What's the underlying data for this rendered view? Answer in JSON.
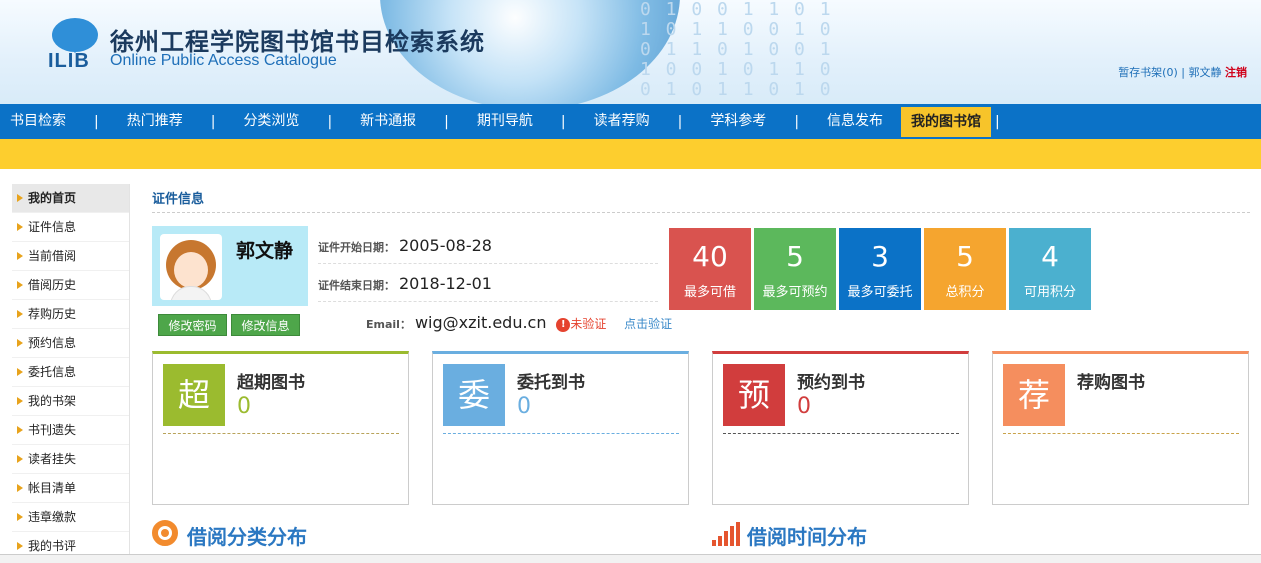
{
  "header": {
    "logo_text": "ILIB",
    "title": "徐州工程学院图书馆书目检索系统",
    "subtitle": "Online Public Access Catalogue",
    "links": {
      "bookshelf": "暂存书架(0)",
      "separator": "|",
      "user": "郭文静",
      "logout": "注销"
    }
  },
  "nav": {
    "items": [
      "书目检索",
      "热门推荐",
      "分类浏览",
      "新书通报",
      "期刊导航",
      "读者荐购",
      "学科参考",
      "信息发布"
    ],
    "separator": "|",
    "active": "我的图书馆"
  },
  "sidebar": {
    "items": [
      "我的首页",
      "证件信息",
      "当前借阅",
      "借阅历史",
      "荐购历史",
      "预约信息",
      "委托信息",
      "我的书架",
      "书刊遗失",
      "读者挂失",
      "帐目清单",
      "违章缴款",
      "我的书评"
    ]
  },
  "section": {
    "title": "证件信息"
  },
  "profile": {
    "name": "郭文静",
    "change_password": "修改密码",
    "change_info": "修改信息",
    "start_label": "证件开始日期：",
    "start_value": "2005-08-28",
    "end_label": "证件结束日期：",
    "end_value": "2018-12-01",
    "email_label": "Email：",
    "email_value": "wig@xzit.edu.cn",
    "warn_glyph": "!",
    "unverified": "未验证",
    "verify_link": "点击验证"
  },
  "stats": [
    {
      "value": "40",
      "label": "最多可借",
      "color": "#d9534f"
    },
    {
      "value": "5",
      "label": "最多可预约",
      "color": "#5cb85c"
    },
    {
      "value": "3",
      "label": "最多可委托",
      "color": "#0b72c7"
    },
    {
      "value": "5",
      "label": "总积分",
      "color": "#f5a52f"
    },
    {
      "value": "4",
      "label": "可用积分",
      "color": "#4bb0cf"
    }
  ],
  "cards": [
    {
      "glyph": "超",
      "title": "超期图书",
      "count": "0",
      "color": "#9bbb2f"
    },
    {
      "glyph": "委",
      "title": "委托到书",
      "count": "0",
      "color": "#6aaee0"
    },
    {
      "glyph": "预",
      "title": "预约到书",
      "count": "0",
      "color": "#d13d3d"
    },
    {
      "glyph": "荐",
      "title": "荐购图书",
      "count": "",
      "color": "#f58e5e"
    }
  ],
  "bottom": {
    "left_title": "借阅分类分布",
    "right_title": "借阅时间分布"
  }
}
